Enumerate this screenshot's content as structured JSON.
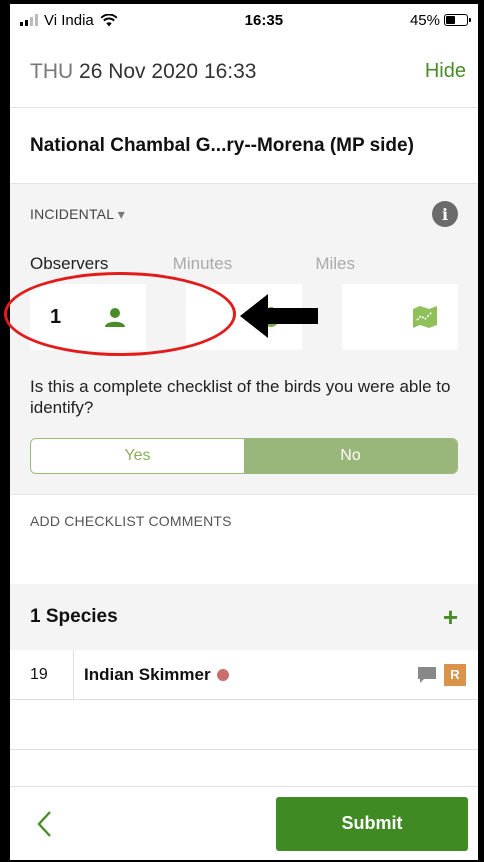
{
  "status": {
    "carrier": "Vi India",
    "time": "16:35",
    "battery": "45%",
    "battery_level": 0.45
  },
  "header": {
    "dow": "THU",
    "datetime": "26 Nov 2020 16:33",
    "hide_label": "Hide"
  },
  "location": {
    "name": "National Chambal G...ry--Morena (MP side)"
  },
  "protocol": {
    "label": "INCIDENTAL",
    "caret": "▾",
    "info_icon": "info-icon"
  },
  "effort": {
    "observers_label": "Observers",
    "minutes_label": "Minutes",
    "miles_label": "Miles",
    "observers_value": "1",
    "minutes_value": "",
    "miles_value": ""
  },
  "complete": {
    "question": "Is this a complete checklist of the birds you were able to identify?",
    "yes": "Yes",
    "no": "No",
    "selected": "No"
  },
  "comments": {
    "label": "ADD CHECKLIST COMMENTS"
  },
  "species": {
    "count_label": "1 Species",
    "add": "+",
    "rows": [
      {
        "count": "19",
        "name": "Indian Skimmer",
        "rare_badge": "R"
      }
    ]
  },
  "footer": {
    "submit_label": "Submit"
  },
  "colors": {
    "accent": "#4a8c2a",
    "submit": "#3f8a22",
    "segment_selected": "#99b77a",
    "rare": "#d9934a",
    "annotation": "#e31b1b"
  }
}
